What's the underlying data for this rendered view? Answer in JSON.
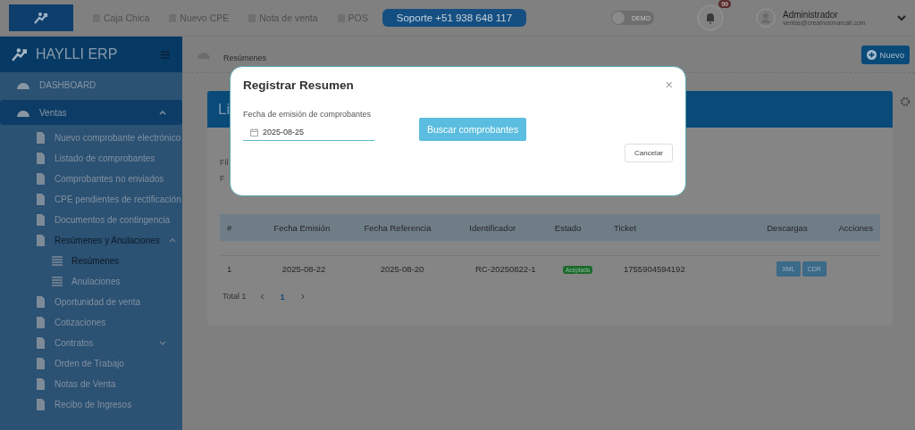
{
  "topbar": {
    "links": [
      {
        "label": "Caja Chica"
      },
      {
        "label": "Nuevo CPE"
      },
      {
        "label": "Nota de venta"
      },
      {
        "label": "POS"
      }
    ],
    "support": "Soporte +51 938 648 117",
    "demo_toggle": {
      "label": "DEMO",
      "on": false
    },
    "notifications": "99",
    "user": {
      "name": "Administrador",
      "email": "ventas@creamosmarcati.com"
    }
  },
  "sidebar": {
    "brand": "HAYLLI ERP",
    "items": [
      {
        "label": "DASHBOARD",
        "selected": false
      },
      {
        "label": "Ventas",
        "selected": true,
        "expanded": true,
        "children": [
          {
            "label": "Nuevo comprobante electrónico",
            "selected": false
          },
          {
            "label": "Listado de comprobantes",
            "selected": false
          },
          {
            "label": "Comprobantes no enviados",
            "selected": false
          },
          {
            "label": "CPE pendientes de rectificación",
            "selected": false
          },
          {
            "label": "Documentos de contingencia",
            "selected": false
          },
          {
            "label": "Resúmenes y Anulaciones",
            "selected": true,
            "expanded": true,
            "children": [
              {
                "label": "Resúmenes",
                "selected": true
              },
              {
                "label": "Anulaciones",
                "selected": false
              }
            ]
          },
          {
            "label": "Oportunidad de venta",
            "selected": false
          },
          {
            "label": "Cotizaciones",
            "selected": false
          },
          {
            "label": "Contratos",
            "selected": false,
            "expanded": false
          },
          {
            "label": "Orden de Trabajo",
            "selected": false
          },
          {
            "label": "Notas de Venta",
            "selected": false
          },
          {
            "label": "Recibo de Ingresos",
            "selected": false
          }
        ]
      }
    ]
  },
  "breadcrumb": "Resúmenes",
  "new_button": "Nuevo",
  "card": {
    "title": "Li",
    "filter_label": "Fil",
    "filter_value": "F",
    "table": {
      "columns": [
        "#",
        "Fecha Emisión",
        "Fecha Referencia",
        "Identificador",
        "Estado",
        "Ticket",
        "Descargas",
        "Acciones"
      ],
      "rows": [
        {
          "index": "1",
          "issue_date": "2025-08-22",
          "reference_date": "2025-08-20",
          "identifier": "RC-20250822-1",
          "status": "Aceptado",
          "ticket": "1755904594192",
          "downloads": [
            "XML",
            "CDR"
          ]
        }
      ]
    },
    "pagination": {
      "total": "Total 1",
      "prev": "‹",
      "pages": [
        {
          "label": "1",
          "selected": true
        }
      ],
      "next": "›"
    }
  },
  "modal": {
    "title": "Registrar Resumen",
    "close": "×",
    "field_label": "Fecha de emisión de comprobantes",
    "date": "2025-08-25",
    "search_button": "Buscar comprobantes",
    "cancel_button": "Cancelar"
  }
}
